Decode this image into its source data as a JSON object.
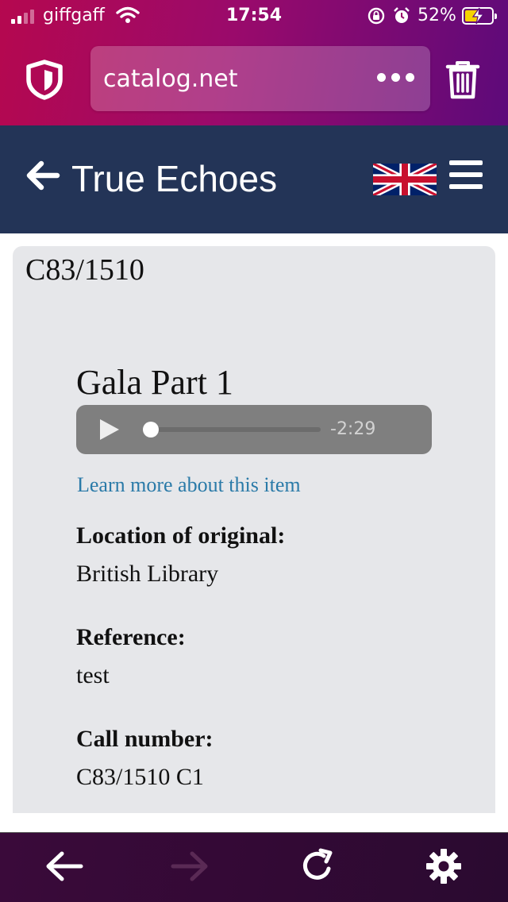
{
  "status_bar": {
    "carrier": "giffgaff",
    "time": "17:54",
    "battery_percent": "52%",
    "battery_level": 0.52,
    "icons": [
      "signal-icon",
      "wifi-icon",
      "rotation-lock-icon",
      "alarm-icon",
      "battery-charging-icon"
    ]
  },
  "browser": {
    "url": "catalog.net",
    "icons": [
      "shield-icon",
      "more-icon",
      "trash-icon"
    ],
    "toolbar_icons": [
      "back-arrow-icon",
      "forward-arrow-icon",
      "reload-icon",
      "settings-gear-icon"
    ],
    "forward_enabled": false
  },
  "site": {
    "title": "True Echoes",
    "language_flag": "united-kingdom-flag-icon",
    "header_color": "#233457"
  },
  "item": {
    "id": "C83/1510",
    "title": "Gala Part 1",
    "audio": {
      "remaining": "-2:29",
      "progress": 0.0
    },
    "learn_more": "Learn more about this item",
    "fields": [
      {
        "label": "Location of original:",
        "value": "British Library"
      },
      {
        "label": "Reference:",
        "value": "test"
      },
      {
        "label": "Call number:",
        "value": "C83/1510 C1"
      }
    ]
  },
  "colors": {
    "browser_gradient_start": "#b5084f",
    "browser_gradient_end": "#5d0a7a",
    "link": "#2a7aa8",
    "card_bg": "#e6e7ea"
  }
}
